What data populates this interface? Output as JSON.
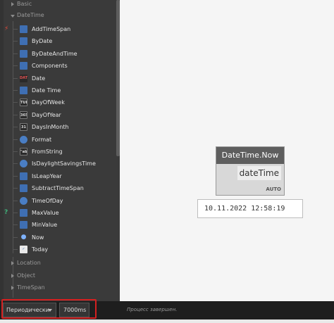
{
  "library": {
    "categories_top": [
      {
        "label": "Basic",
        "expanded": false
      },
      {
        "label": "DateTime",
        "expanded": true
      }
    ],
    "items": [
      {
        "label": "AddTimeSpan",
        "icon": "add-timespan-icon",
        "glyph": "",
        "style": "g-blue",
        "mark": "⚡",
        "mark_color": "#e04a3a"
      },
      {
        "label": "ByDate",
        "icon": "calendar-icon",
        "glyph": "",
        "style": "g-blue"
      },
      {
        "label": "ByDateAndTime",
        "icon": "calendar-clock-icon",
        "glyph": "",
        "style": "g-blue"
      },
      {
        "label": "Components",
        "icon": "components-icon",
        "glyph": "",
        "style": "g-blue"
      },
      {
        "label": "Date",
        "icon": "date-icon",
        "glyph": "DATE",
        "style": "g-red"
      },
      {
        "label": "Date Time",
        "icon": "datetime-icon",
        "glyph": "",
        "style": "g-blue"
      },
      {
        "label": "DayOfWeek",
        "icon": "day-of-week-icon",
        "glyph": "TUE",
        "style": "g-dark"
      },
      {
        "label": "DayOfYear",
        "icon": "day-of-year-icon",
        "glyph": "365",
        "style": "g-dark"
      },
      {
        "label": "DaysInMonth",
        "icon": "days-in-month-icon",
        "glyph": "31",
        "style": "g-dark"
      },
      {
        "label": "Format",
        "icon": "format-icon",
        "glyph": "",
        "style": "g-clock"
      },
      {
        "label": "FromString",
        "icon": "from-string-icon",
        "glyph": "\"abc\"",
        "style": "g-dark"
      },
      {
        "label": "IsDaylightSavingsTime",
        "icon": "daylight-savings-icon",
        "glyph": "",
        "style": "g-clock"
      },
      {
        "label": "IsLeapYear",
        "icon": "leap-year-icon",
        "glyph": "",
        "style": "g-blue"
      },
      {
        "label": "SubtractTimeSpan",
        "icon": "subtract-timespan-icon",
        "glyph": "",
        "style": "g-blue"
      },
      {
        "label": "TimeOfDay",
        "icon": "time-of-day-icon",
        "glyph": "",
        "style": "g-clock"
      },
      {
        "label": "MaxValue",
        "icon": "max-value-icon",
        "glyph": "",
        "style": "g-blue",
        "mark": "?",
        "mark_color": "#3fb37a"
      },
      {
        "label": "MinValue",
        "icon": "min-value-icon",
        "glyph": "",
        "style": "g-blue"
      },
      {
        "label": "Now",
        "icon": "now-pin-icon",
        "glyph": "●",
        "style": "g-pin"
      },
      {
        "label": "Today",
        "icon": "today-calendar-icon",
        "glyph": "✓",
        "style": "g-cal"
      }
    ],
    "categories_bottom": [
      {
        "label": "Location",
        "expanded": false
      },
      {
        "label": "Object",
        "expanded": false
      },
      {
        "label": "TimeSpan",
        "expanded": false
      }
    ]
  },
  "canvas": {
    "node": {
      "title": "DateTime.Now",
      "output_port": "dateTime",
      "lacing": "AUTO"
    },
    "preview_value": "10.11.2022 12:58:19"
  },
  "bottom_bar": {
    "run_mode": "Периодически",
    "period": "7000ms",
    "status": "Процесс завершен."
  },
  "colors": {
    "library_bg": "#3a3a3a",
    "canvas_bg": "#f5f5f5",
    "node_header": "#5e5e5e",
    "highlight": "#d42020"
  }
}
